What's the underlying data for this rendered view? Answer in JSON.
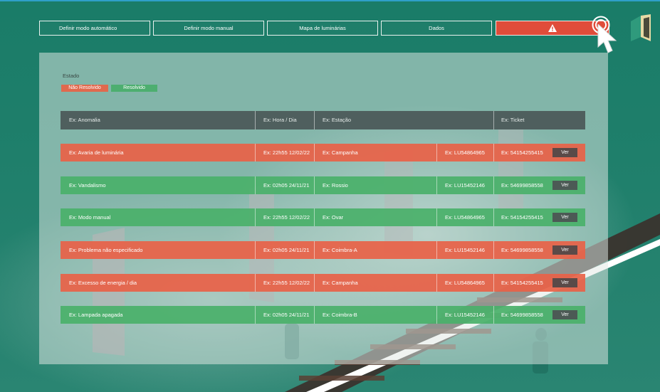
{
  "nav": {
    "auto_label": "Definir modo automático",
    "manual_label": "Definir modo manual",
    "map_label": "Mapa de luminárias",
    "data_label": "Dados"
  },
  "colors": {
    "unresolved": "#e0694e",
    "resolved": "#4dae70",
    "alert": "#e04c3a",
    "header": "#4f5f5e"
  },
  "legend": {
    "title": "Estado",
    "unresolved": "Não Resolvido",
    "resolved": "Resolvido"
  },
  "table": {
    "headers": {
      "anomalia": "Ex: Anomalia",
      "hora": "Ex: Hora / Dia",
      "estacao": "Ex: Estação",
      "ticket": "Ex: Ticket"
    },
    "view_label": "Ver",
    "rows": [
      {
        "status": "unresolved",
        "anomalia": "Ex: Avaria de luminária",
        "hora": "Ex: 22h55  12/02/22",
        "estacao": "Ex: Campanha",
        "luminaria": "Ex: LU54864965",
        "ticket": "Ex: 54154255415"
      },
      {
        "status": "resolved",
        "anomalia": "Ex: Vandalismo",
        "hora": "Ex: 02h05  24/11/21",
        "estacao": "Ex: Rossio",
        "luminaria": "Ex: LU15452146",
        "ticket": "Ex: 54699858558"
      },
      {
        "status": "resolved",
        "anomalia": "Ex: Modo manual",
        "hora": "Ex: 22h55  12/02/22",
        "estacao": "Ex: Ovar",
        "luminaria": "Ex: LU54864965",
        "ticket": "Ex: 54154255415"
      },
      {
        "status": "unresolved",
        "anomalia": "Ex: Problema não especificado",
        "hora": "Ex: 02h05  24/11/21",
        "estacao": "Ex: Coimbra-A",
        "luminaria": "Ex: LU15452146",
        "ticket": "Ex: 54699858558"
      },
      {
        "status": "unresolved",
        "anomalia": "Ex: Excesso de energia / dia",
        "hora": "Ex: 22h55  12/02/22",
        "estacao": "Ex: Campanha",
        "luminaria": "Ex: LU54864965",
        "ticket": "Ex: 54154255415"
      },
      {
        "status": "resolved",
        "anomalia": "Ex: Lampada apagada",
        "hora": "Ex: 02h05  24/11/21",
        "estacao": "Ex: Coimbra-B",
        "luminaria": "Ex: LU15452146",
        "ticket": "Ex: 54699858558"
      }
    ]
  },
  "icons": {
    "alert": "warning-triangle-icon",
    "target": "target-icon",
    "cursor": "cursor-hand-icon",
    "logo": "lamp-logo-icon"
  }
}
